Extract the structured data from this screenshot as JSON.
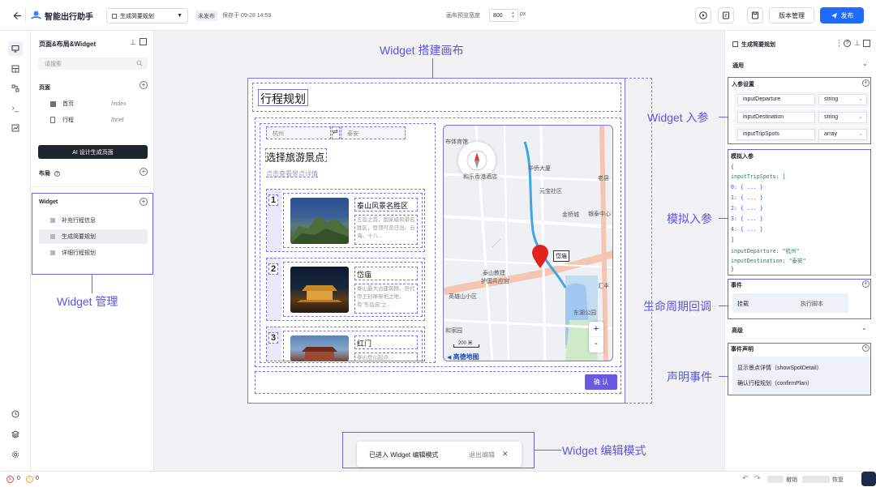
{
  "header": {
    "app_title": "智能出行助手",
    "widget_selector": "生成简要规划",
    "status_badge": "未发布",
    "save_time": "保存于 09-28 14:59",
    "canvas_width_label": "画布预览宽度",
    "canvas_width_value": "800",
    "canvas_width_unit": "px",
    "version_button": "版本管理",
    "publish_button": "发布"
  },
  "left_panel": {
    "title": "页面&布局&Widget",
    "search_placeholder": "请搜索",
    "pages_section": "页面",
    "pages": [
      {
        "name": "首页",
        "path": "/index"
      },
      {
        "name": "行程",
        "path": "/brief"
      }
    ],
    "ai_button": "AI 设计生成页面",
    "layout_section": "布局",
    "widget_section": "Widget",
    "widgets": [
      "补充行程信息",
      "生成简要规划",
      "详细行程规划"
    ],
    "selected_widget": 1
  },
  "canvas": {
    "page_title": "行程规划",
    "from_city": "杭州",
    "swap_glyph": "⇄",
    "to_city": "泰安",
    "section_title": "选择旅游景点",
    "section_hint": "点击查看景点详情",
    "spots": [
      {
        "index": "1",
        "name": "泰山风景名胜区",
        "desc": "五岳之首，国家级风景名胜区，登顶可览日出、云海、十八..."
      },
      {
        "index": "2",
        "name": "岱庙",
        "desc": "泰山最大古建筑群，历代帝王封禅祭祀之地，有“东岳庙”之..."
      },
      {
        "index": "3",
        "name": "红门",
        "desc": "泰山登山起点..."
      }
    ],
    "map_labels": [
      "布体育馆",
      "华侨大厦",
      "和乐香港酒店",
      "元宝社区",
      "老县",
      "金桥城",
      "银泰中心",
      "泰山教建",
      "护国兵应宫",
      "英雄山小区",
      "汇丰",
      "东湖公园",
      "和家园"
    ],
    "map_poi": "岱庙",
    "map_scale": "200 米",
    "map_brand": "高德地图",
    "zoom_in": "+",
    "zoom_out": "-",
    "confirm_button": "确 认"
  },
  "edit_mode": {
    "text": "已进入 Widget 编辑模式",
    "exit": "退出编辑",
    "close": "✕"
  },
  "right_panel": {
    "title": "生成简要规划",
    "general_section": "通用",
    "input_params_title": "入参设置",
    "params": [
      {
        "name": "inputDeparture",
        "type": "string"
      },
      {
        "name": "inputDestination",
        "type": "string"
      },
      {
        "name": "inputTripSpots",
        "type": "array"
      }
    ],
    "mock_title": "模拟入参",
    "mock_lines": [
      "{",
      "  inputTripSpots: [",
      "    0: { ... }",
      "    1: { ... }",
      "    2: { ... }",
      "    3: { ... }",
      "    4: { ... }",
      "  ]",
      "  inputDeparture: \"杭州\"",
      "  inputDestination: \"泰安\"",
      "}"
    ],
    "events_title": "事件",
    "lifecycle_name": "挂载",
    "lifecycle_action": "执行脚本",
    "advanced_section": "高级",
    "declare_title": "事件声明",
    "declared_events": [
      "显示景点详情（showSpotDetail）",
      "确认行程规划（confirmPlan）"
    ]
  },
  "annotations": {
    "canvas": "Widget 搭建画布",
    "widget_mgmt": "Widget 管理",
    "input_params": "Widget 入参",
    "mock_params": "模拟入参",
    "lifecycle": "生命周期回调",
    "declare_events": "声明事件",
    "edit_mode": "Widget 编辑模式"
  },
  "status_bar": {
    "errors": "0",
    "warnings": "0",
    "undo": "撤销",
    "redo": "恢复"
  },
  "colors": {
    "accent": "#1f6bff",
    "annotation": "#5b55e6",
    "selection": "#7b76ec",
    "confirm": "#6a5ae0"
  }
}
